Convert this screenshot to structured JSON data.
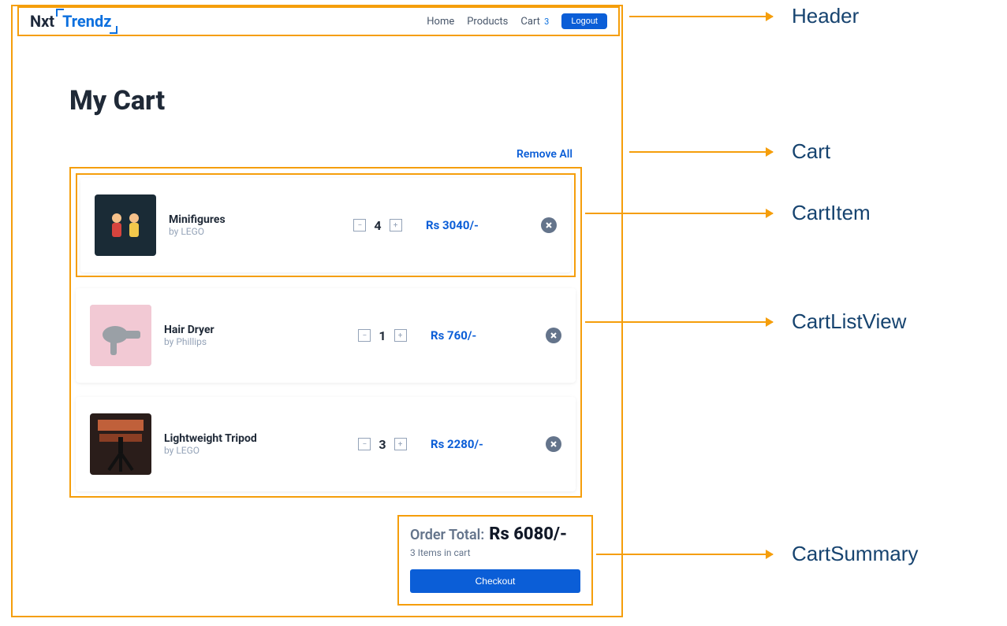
{
  "header": {
    "logo_part1": "Nxt",
    "logo_part2": "Trendz",
    "nav": {
      "home": "Home",
      "products": "Products",
      "cart": "Cart",
      "cart_count": "3"
    },
    "logout_label": "Logout"
  },
  "cart": {
    "title": "My Cart",
    "remove_all_label": "Remove All",
    "items": [
      {
        "title": "Minifigures",
        "brand": "by LEGO",
        "qty": "4",
        "price": "Rs 3040/-"
      },
      {
        "title": "Hair Dryer",
        "brand": "by Phillips",
        "qty": "1",
        "price": "Rs 760/-"
      },
      {
        "title": "Lightweight Tripod",
        "brand": "by LEGO",
        "qty": "3",
        "price": "Rs 2280/-"
      }
    ]
  },
  "summary": {
    "label": "Order Total:",
    "amount": "Rs 6080/-",
    "count_text": "3 Items in cart",
    "checkout_label": "Checkout"
  },
  "annotations": {
    "header": "Header",
    "cart": "Cart",
    "cart_item": "CartItem",
    "cart_list": "CartListView",
    "summary": "CartSummary"
  },
  "icons": {
    "minus": "−",
    "plus": "+"
  }
}
